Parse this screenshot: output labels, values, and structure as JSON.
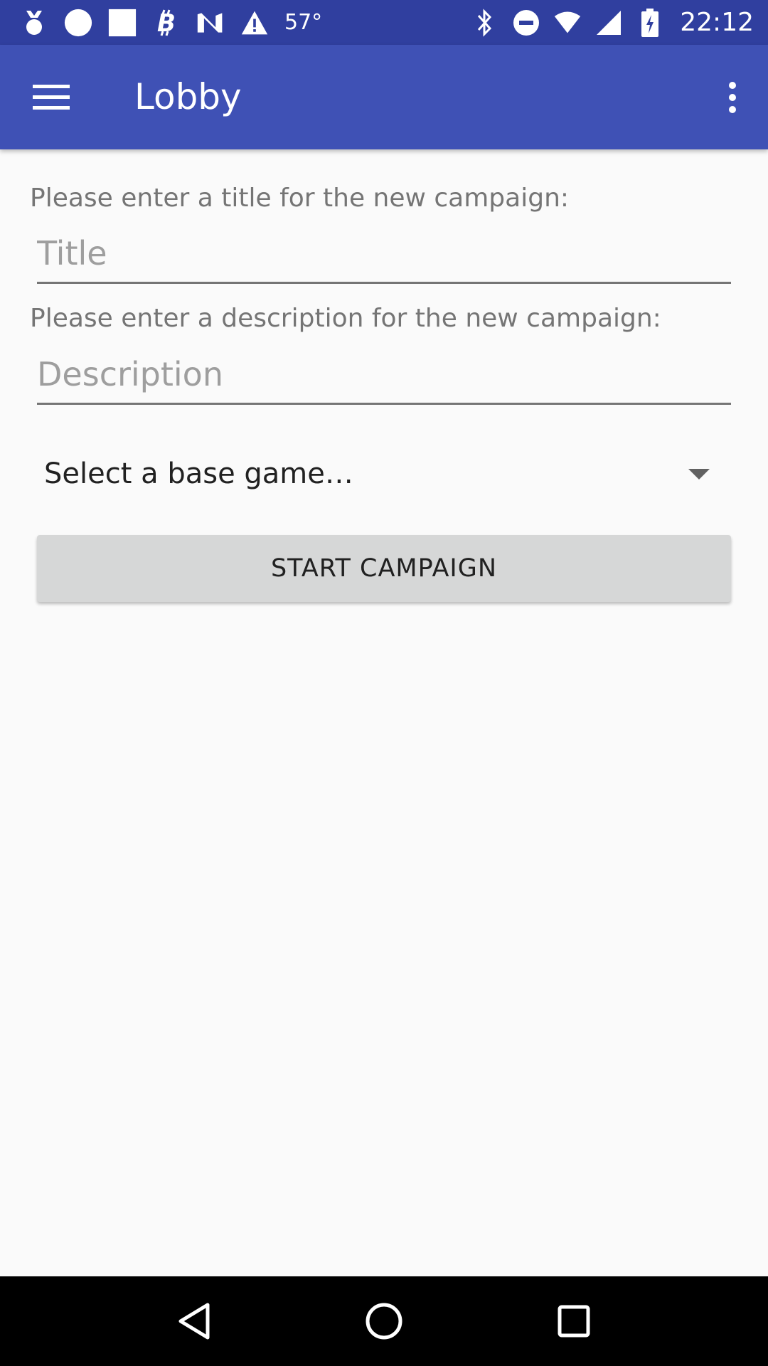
{
  "status_bar": {
    "temperature": "57°",
    "clock": "22:12",
    "left_icons": [
      "medal-icon",
      "circle-icon",
      "square-icon",
      "bitcoin-icon",
      "n-logo-icon",
      "warning-icon"
    ],
    "right_icons": [
      "bluetooth-icon",
      "do-not-disturb-icon",
      "wifi-icon",
      "cell-signal-icon",
      "battery-charging-icon"
    ]
  },
  "app_bar": {
    "title": "Lobby",
    "menu_icon": "hamburger-menu-icon",
    "overflow_icon": "more-vert-icon",
    "color": "#3f51b5",
    "status_color": "#303f9f"
  },
  "form": {
    "title_label": "Please enter a title for the new campaign:",
    "title_placeholder": "Title",
    "title_value": "",
    "description_label": "Please enter a description for the new campaign:",
    "description_placeholder": "Description",
    "description_value": "",
    "base_game_selected": "Select a base game…",
    "start_button_label": "START CAMPAIGN"
  },
  "nav_bar": {
    "back_icon": "back-triangle-icon",
    "home_icon": "home-circle-icon",
    "recents_icon": "recents-square-icon"
  }
}
